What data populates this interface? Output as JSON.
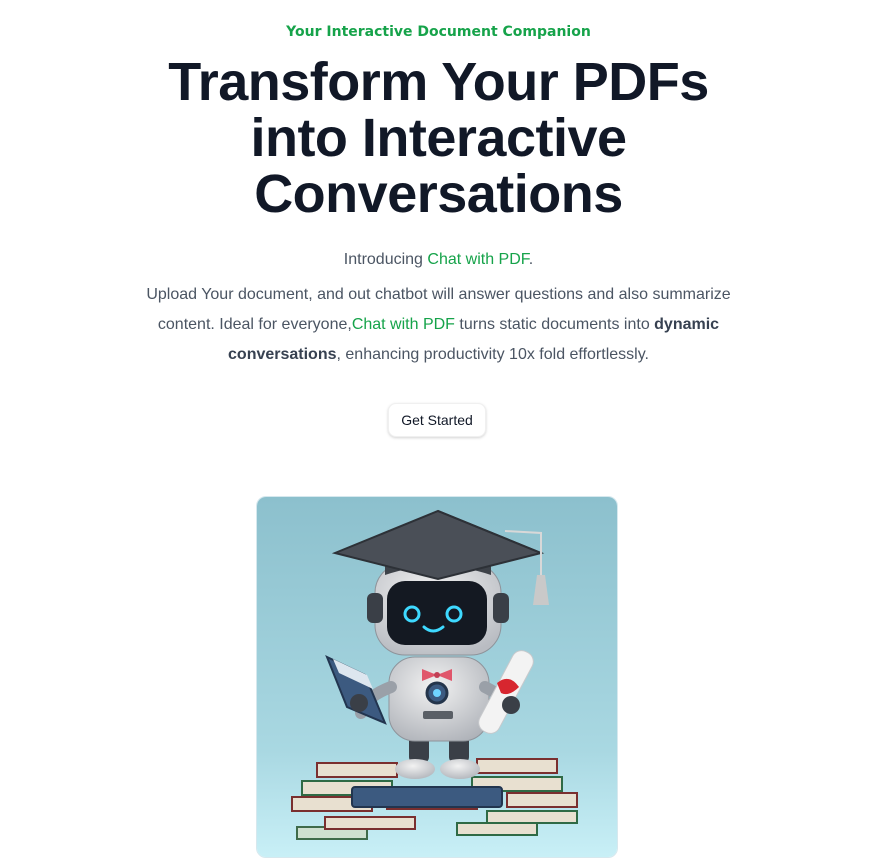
{
  "hero": {
    "eyebrow": "Your Interactive Document Companion",
    "headline": "Transform Your PDFs into Interactive Conversations",
    "intro": {
      "prefix": "Introducing ",
      "brand": "Chat with PDF",
      "suffix": "."
    },
    "description": {
      "part1": "Upload Your document, and out chatbot will answer questions and also summarize content. Ideal for everyone,",
      "brand": "Chat with PDF",
      "part2": " turns static documents into ",
      "emphasis": "dynamic conversations",
      "part3": ", enhancing productivity 10x fold effortlessly."
    },
    "cta_label": "Get Started",
    "image_alt": "robot-graduate-illustration"
  },
  "colors": {
    "accent": "#16a34a",
    "headline": "#111827",
    "body": "#4b5563",
    "image_bg": "#8fc3cf"
  }
}
